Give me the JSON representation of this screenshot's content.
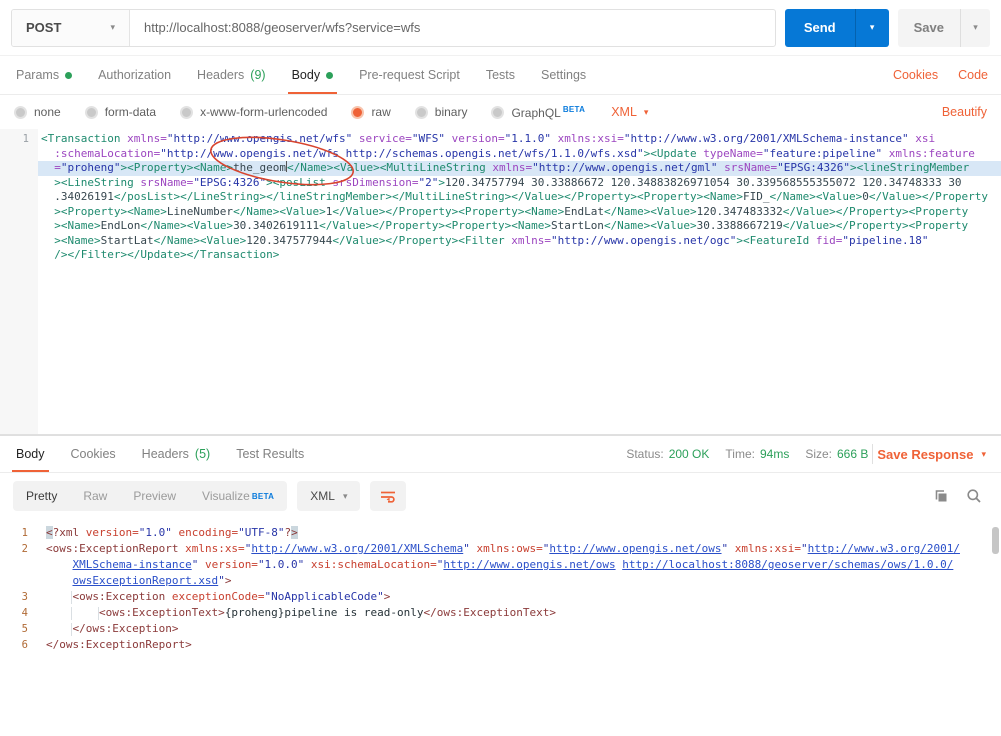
{
  "accent_color": "#EF6237",
  "green_color": "#2CA05A",
  "send_blue": "#0678D6",
  "request_bar": {
    "method": "POST",
    "url": "http://localhost:8088/geoserver/wfs?service=wfs",
    "send_label": "Send",
    "save_label": "Save"
  },
  "request_tabs": {
    "items": [
      {
        "id": "params",
        "label": "Params",
        "dot": true
      },
      {
        "id": "authorization",
        "label": "Authorization"
      },
      {
        "id": "headers",
        "label": "Headers",
        "count": "(9)"
      },
      {
        "id": "body",
        "label": "Body",
        "dot": true,
        "active": true
      },
      {
        "id": "pre-request-script",
        "label": "Pre-request Script"
      },
      {
        "id": "tests",
        "label": "Tests"
      },
      {
        "id": "settings",
        "label": "Settings"
      }
    ],
    "cookies_label": "Cookies",
    "code_label": "Code"
  },
  "body_type_bar": {
    "options": [
      {
        "id": "none",
        "label": "none"
      },
      {
        "id": "form-data",
        "label": "form-data"
      },
      {
        "id": "x-www-form-urlencoded",
        "label": "x-www-form-urlencoded"
      },
      {
        "id": "raw",
        "label": "raw",
        "selected": true
      },
      {
        "id": "binary",
        "label": "binary"
      },
      {
        "id": "graphql",
        "label": "GraphQL",
        "beta": "BETA"
      }
    ],
    "format": "XML",
    "beautify_label": "Beautify"
  },
  "request_editor": {
    "lines": [
      {
        "num": "1",
        "rows": [
          {
            "tokens": [
              [
                "tag",
                "<Transaction "
              ],
              [
                "attr",
                "xmlns="
              ],
              [
                "str",
                "\"http://www.opengis.net/wfs\""
              ],
              [
                "txt",
                " "
              ],
              [
                "attr",
                "service="
              ],
              [
                "str",
                "\"WFS\""
              ],
              [
                "txt",
                " "
              ],
              [
                "attr",
                "version="
              ],
              [
                "str",
                "\"1.1.0\""
              ],
              [
                "txt",
                " "
              ],
              [
                "attr",
                "xmlns:xsi="
              ],
              [
                "str",
                "\"http://www.w3.org/2001/XMLSchema-instance\""
              ],
              [
                "txt",
                " "
              ],
              [
                "attr",
                "xsi"
              ]
            ]
          },
          {
            "cont": true,
            "tokens": [
              [
                "attr",
                ":schemaLocation="
              ],
              [
                "str",
                "\"http://www.opengis.net/wfs http://schemas.opengis.net/wfs/1.1.0/wfs.xsd\""
              ],
              [
                "tag",
                "><Update "
              ],
              [
                "attr",
                "typeName="
              ],
              [
                "str",
                "\"feature:pipeline\""
              ],
              [
                "txt",
                " "
              ],
              [
                "attr",
                "xmlns:feature"
              ]
            ]
          },
          {
            "cont": true,
            "sel": true,
            "tokens": [
              [
                "attr",
                "="
              ],
              [
                "str",
                "\"proheng\""
              ],
              [
                "tag",
                "><Property><Name>"
              ],
              [
                "txt",
                "the_geom"
              ],
              [
                "cur",
                ""
              ],
              [
                "tag",
                "</Name><Value><MultiLineString "
              ],
              [
                "attr",
                "xmlns="
              ],
              [
                "str",
                "\"http://www.opengis.net/gml\""
              ],
              [
                "txt",
                " "
              ],
              [
                "attr",
                "srsName="
              ],
              [
                "str",
                "\"EPSG:4326\""
              ],
              [
                "tag",
                "><lineStringMember"
              ]
            ]
          },
          {
            "cont": true,
            "tokens": [
              [
                "tag",
                "><LineString "
              ],
              [
                "attr",
                "srsName="
              ],
              [
                "str",
                "\"EPSG:4326\""
              ],
              [
                "tag",
                "><posList "
              ],
              [
                "attr",
                "srsDimension="
              ],
              [
                "str",
                "\"2\""
              ],
              [
                "tag",
                ">"
              ],
              [
                "txt",
                "120.34757794 30.33886672 120.34883826971054 30.339568555355072 120.34748333 30"
              ]
            ]
          },
          {
            "cont": true,
            "tokens": [
              [
                "txt",
                ".34026191"
              ],
              [
                "tag",
                "</posList></LineString></lineStringMember></MultiLineString></Value></Property><Property><Name>"
              ],
              [
                "txt",
                "FID_"
              ],
              [
                "tag",
                "</Name><Value>"
              ],
              [
                "txt",
                "0"
              ],
              [
                "tag",
                "</Value></Property"
              ]
            ]
          },
          {
            "cont": true,
            "tokens": [
              [
                "tag",
                "><Property><Name>"
              ],
              [
                "txt",
                "LineNumber"
              ],
              [
                "tag",
                "</Name><Value>"
              ],
              [
                "txt",
                "1"
              ],
              [
                "tag",
                "</Value></Property><Property><Name>"
              ],
              [
                "txt",
                "EndLat"
              ],
              [
                "tag",
                "</Name><Value>"
              ],
              [
                "txt",
                "120.347483332"
              ],
              [
                "tag",
                "</Value></Property><Property"
              ]
            ]
          },
          {
            "cont": true,
            "tokens": [
              [
                "tag",
                "><Name>"
              ],
              [
                "txt",
                "EndLon"
              ],
              [
                "tag",
                "</Name><Value>"
              ],
              [
                "txt",
                "30.3402619111"
              ],
              [
                "tag",
                "</Value></Property><Property><Name>"
              ],
              [
                "txt",
                "StartLon"
              ],
              [
                "tag",
                "</Name><Value>"
              ],
              [
                "txt",
                "30.3388667219"
              ],
              [
                "tag",
                "</Value></Property><Property"
              ]
            ]
          },
          {
            "cont": true,
            "tokens": [
              [
                "tag",
                "><Name>"
              ],
              [
                "txt",
                "StartLat"
              ],
              [
                "tag",
                "</Name><Value>"
              ],
              [
                "txt",
                "120.347577944"
              ],
              [
                "tag",
                "</Value></Property><Filter "
              ],
              [
                "attr",
                "xmlns="
              ],
              [
                "str",
                "\"http://www.opengis.net/ogc\""
              ],
              [
                "tag",
                "><FeatureId "
              ],
              [
                "attr",
                "fid="
              ],
              [
                "str",
                "\"pipeline.18\""
              ]
            ]
          },
          {
            "cont": true,
            "tokens": [
              [
                "tag",
                "/></Filter></Update></Transaction>"
              ]
            ]
          }
        ]
      }
    ]
  },
  "annotation": {
    "shape": "hand-drawn-ellipse",
    "color": "#d8442e"
  },
  "response_meta": {
    "tabs": [
      {
        "id": "body",
        "label": "Body",
        "active": true
      },
      {
        "id": "cookies",
        "label": "Cookies"
      },
      {
        "id": "headers",
        "label": "Headers",
        "count": "(5)"
      },
      {
        "id": "test-results",
        "label": "Test Results"
      }
    ],
    "metrics": [
      {
        "id": "status",
        "label": "Status:",
        "value": "200 OK"
      },
      {
        "id": "time",
        "label": "Time:",
        "value": "94ms"
      },
      {
        "id": "size",
        "label": "Size:",
        "value": "666 B"
      }
    ],
    "save_response_label": "Save Response"
  },
  "response_toolbar": {
    "views": [
      {
        "id": "pretty",
        "label": "Pretty",
        "active": true
      },
      {
        "id": "raw",
        "label": "Raw"
      },
      {
        "id": "preview",
        "label": "Preview"
      },
      {
        "id": "visualize",
        "label": "Visualize",
        "beta": "BETA"
      }
    ],
    "format": "XML"
  },
  "response_editor": {
    "lines": [
      {
        "num": "1",
        "rows": [
          {
            "tokens": [
              [
                "hlb",
                "<"
              ],
              [
                "tag",
                "?xml "
              ],
              [
                "attr",
                "version="
              ],
              [
                "str",
                "\"1.0\""
              ],
              [
                "txt",
                " "
              ],
              [
                "attr",
                "encoding="
              ],
              [
                "str",
                "\"UTF-8\""
              ],
              [
                "tag",
                "?"
              ],
              [
                "hlb",
                ">"
              ]
            ]
          }
        ]
      },
      {
        "num": "2",
        "rows": [
          {
            "tokens": [
              [
                "tag",
                "<ows:ExceptionReport "
              ],
              [
                "attr",
                "xmlns:xs="
              ],
              [
                "str",
                "\""
              ],
              [
                "lnk",
                "http://www.w3.org/2001/XMLSchema"
              ],
              [
                "str",
                "\""
              ],
              [
                "txt",
                " "
              ],
              [
                "attr",
                "xmlns:ows="
              ],
              [
                "str",
                "\""
              ],
              [
                "lnk",
                "http://www.opengis.net/ows"
              ],
              [
                "str",
                "\""
              ],
              [
                "txt",
                " "
              ],
              [
                "attr",
                "xmlns:xsi="
              ],
              [
                "str",
                "\""
              ],
              [
                "lnk",
                "http://www.w3.org/2001/"
              ]
            ]
          },
          {
            "cont": true,
            "tokens": [
              [
                "lnk",
                "XMLSchema-instance"
              ],
              [
                "str",
                "\""
              ],
              [
                "txt",
                " "
              ],
              [
                "attr",
                "version="
              ],
              [
                "str",
                "\"1.0.0\""
              ],
              [
                "txt",
                " "
              ],
              [
                "attr",
                "xsi:schemaLocation="
              ],
              [
                "str",
                "\""
              ],
              [
                "lnk",
                "http://www.opengis.net/ows"
              ],
              [
                "txt",
                " "
              ],
              [
                "lnk",
                "http://localhost:8088/geoserver/schemas/ows/1.0.0/"
              ]
            ]
          },
          {
            "cont": true,
            "tokens": [
              [
                "lnk",
                "owsExceptionReport.xsd"
              ],
              [
                "str",
                "\""
              ],
              [
                "tag",
                ">"
              ]
            ]
          }
        ]
      },
      {
        "num": "3",
        "rows": [
          {
            "tokens": [
              [
                "ind",
                ""
              ],
              [
                "tag",
                "<ows:Exception "
              ],
              [
                "attr",
                "exceptionCode="
              ],
              [
                "str",
                "\"NoApplicableCode\""
              ],
              [
                "tag",
                ">"
              ]
            ]
          }
        ]
      },
      {
        "num": "4",
        "rows": [
          {
            "tokens": [
              [
                "ind",
                ""
              ],
              [
                "ind",
                ""
              ],
              [
                "tag",
                "<ows:ExceptionText>"
              ],
              [
                "txt",
                "{proheng}pipeline is read-only"
              ],
              [
                "tag",
                "</ows:ExceptionText>"
              ]
            ]
          }
        ]
      },
      {
        "num": "5",
        "rows": [
          {
            "tokens": [
              [
                "ind",
                ""
              ],
              [
                "tag",
                "</ows:Exception>"
              ]
            ]
          }
        ]
      },
      {
        "num": "6",
        "rows": [
          {
            "tokens": [
              [
                "tag",
                "</ows:ExceptionReport>"
              ]
            ]
          }
        ]
      }
    ]
  }
}
